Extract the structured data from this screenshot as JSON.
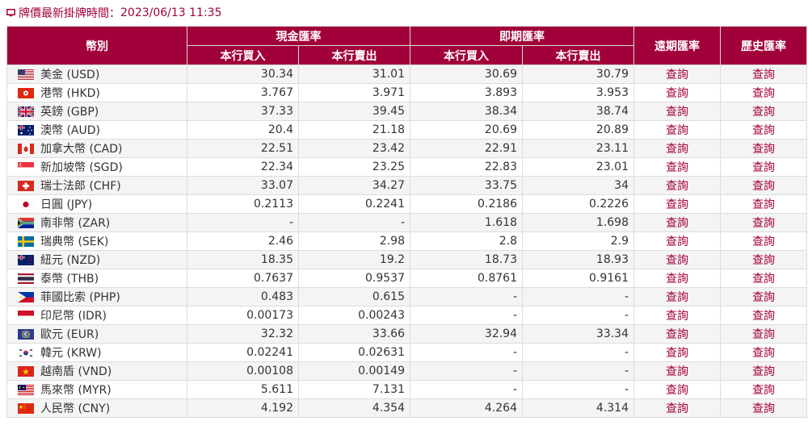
{
  "update_line": {
    "label": "牌價最新掛牌時間：",
    "timestamp": "2023/06/13 11:35"
  },
  "headers": {
    "currency": "幣別",
    "cash_group": "現金匯率",
    "spot_group": "即期匯率",
    "forward": "遠期匯率",
    "history": "歷史匯率",
    "buy": "本行買入",
    "sell": "本行賣出"
  },
  "colors": {
    "brand": "#a2003a",
    "link": "#a3003d",
    "row_alt": "#f4f4f4"
  },
  "rows": [
    {
      "name": "美金 (USD)",
      "flag": "usa-flag-icon",
      "cash_buy": "30.34",
      "cash_sell": "31.01",
      "spot_buy": "30.69",
      "spot_sell": "30.79",
      "forward": "查詢",
      "history": "查詢"
    },
    {
      "name": "港幣 (HKD)",
      "flag": "hongkong-flag-icon",
      "cash_buy": "3.767",
      "cash_sell": "3.971",
      "spot_buy": "3.893",
      "spot_sell": "3.953",
      "forward": "查詢",
      "history": "查詢"
    },
    {
      "name": "英鎊 (GBP)",
      "flag": "uk-flag-icon",
      "cash_buy": "37.33",
      "cash_sell": "39.45",
      "spot_buy": "38.34",
      "spot_sell": "38.74",
      "forward": "查詢",
      "history": "查詢"
    },
    {
      "name": "澳幣 (AUD)",
      "flag": "australia-flag-icon",
      "cash_buy": "20.4",
      "cash_sell": "21.18",
      "spot_buy": "20.69",
      "spot_sell": "20.89",
      "forward": "查詢",
      "history": "查詢"
    },
    {
      "name": "加拿大幣 (CAD)",
      "flag": "canada-flag-icon",
      "cash_buy": "22.51",
      "cash_sell": "23.42",
      "spot_buy": "22.91",
      "spot_sell": "23.11",
      "forward": "查詢",
      "history": "查詢"
    },
    {
      "name": "新加坡幣 (SGD)",
      "flag": "singapore-flag-icon",
      "cash_buy": "22.34",
      "cash_sell": "23.25",
      "spot_buy": "22.83",
      "spot_sell": "23.01",
      "forward": "查詢",
      "history": "查詢"
    },
    {
      "name": "瑞士法郎 (CHF)",
      "flag": "switzerland-flag-icon",
      "cash_buy": "33.07",
      "cash_sell": "34.27",
      "spot_buy": "33.75",
      "spot_sell": "34",
      "forward": "查詢",
      "history": "查詢"
    },
    {
      "name": "日圓 (JPY)",
      "flag": "japan-flag-icon",
      "cash_buy": "0.2113",
      "cash_sell": "0.2241",
      "spot_buy": "0.2186",
      "spot_sell": "0.2226",
      "forward": "查詢",
      "history": "查詢"
    },
    {
      "name": "南非幣 (ZAR)",
      "flag": "southafrica-flag-icon",
      "cash_buy": "-",
      "cash_sell": "-",
      "spot_buy": "1.618",
      "spot_sell": "1.698",
      "forward": "查詢",
      "history": "查詢"
    },
    {
      "name": "瑞典幣 (SEK)",
      "flag": "sweden-flag-icon",
      "cash_buy": "2.46",
      "cash_sell": "2.98",
      "spot_buy": "2.8",
      "spot_sell": "2.9",
      "forward": "查詢",
      "history": "查詢"
    },
    {
      "name": "紐元 (NZD)",
      "flag": "newzealand-flag-icon",
      "cash_buy": "18.35",
      "cash_sell": "19.2",
      "spot_buy": "18.73",
      "spot_sell": "18.93",
      "forward": "查詢",
      "history": "查詢"
    },
    {
      "name": "泰幣 (THB)",
      "flag": "thailand-flag-icon",
      "cash_buy": "0.7637",
      "cash_sell": "0.9537",
      "spot_buy": "0.8761",
      "spot_sell": "0.9161",
      "forward": "查詢",
      "history": "查詢"
    },
    {
      "name": "菲國比索 (PHP)",
      "flag": "philippines-flag-icon",
      "cash_buy": "0.483",
      "cash_sell": "0.615",
      "spot_buy": "-",
      "spot_sell": "-",
      "forward": "查詢",
      "history": "查詢"
    },
    {
      "name": "印尼幣 (IDR)",
      "flag": "indonesia-flag-icon",
      "cash_buy": "0.00173",
      "cash_sell": "0.00243",
      "spot_buy": "-",
      "spot_sell": "-",
      "forward": "查詢",
      "history": "查詢"
    },
    {
      "name": "歐元 (EUR)",
      "flag": "eu-flag-icon",
      "cash_buy": "32.32",
      "cash_sell": "33.66",
      "spot_buy": "32.94",
      "spot_sell": "33.34",
      "forward": "查詢",
      "history": "查詢"
    },
    {
      "name": "韓元 (KRW)",
      "flag": "korea-flag-icon",
      "cash_buy": "0.02241",
      "cash_sell": "0.02631",
      "spot_buy": "-",
      "spot_sell": "-",
      "forward": "查詢",
      "history": "查詢"
    },
    {
      "name": "越南盾 (VND)",
      "flag": "vietnam-flag-icon",
      "cash_buy": "0.00108",
      "cash_sell": "0.00149",
      "spot_buy": "-",
      "spot_sell": "-",
      "forward": "查詢",
      "history": "查詢"
    },
    {
      "name": "馬來幣 (MYR)",
      "flag": "malaysia-flag-icon",
      "cash_buy": "5.611",
      "cash_sell": "7.131",
      "spot_buy": "-",
      "spot_sell": "-",
      "forward": "查詢",
      "history": "查詢"
    },
    {
      "name": "人民幣 (CNY)",
      "flag": "china-flag-icon",
      "cash_buy": "4.192",
      "cash_sell": "4.354",
      "spot_buy": "4.264",
      "spot_sell": "4.314",
      "forward": "查詢",
      "history": "查詢"
    }
  ]
}
